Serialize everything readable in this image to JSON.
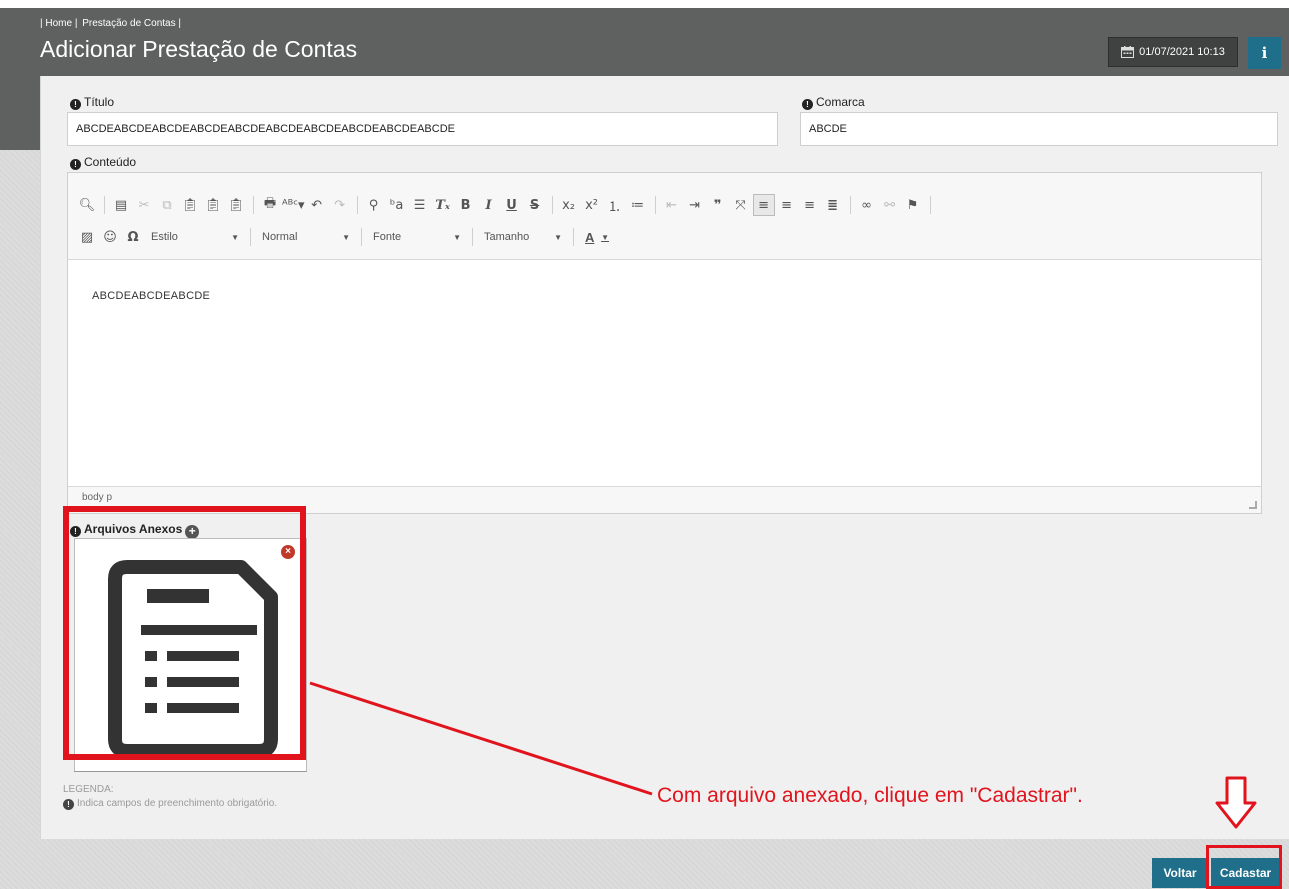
{
  "breadcrumb": [
    "| Home |",
    "Prestação de Contas |"
  ],
  "page": {
    "title": "Adicionar Prestação de Contas",
    "datetime": "01/07/2021 10:13"
  },
  "form": {
    "titulo": {
      "label": "Título",
      "value": "ABCDEABCDEABCDEABCDEABCDEABCDEABCDEABCDEABCDEABCDE"
    },
    "comarca": {
      "label": "Comarca",
      "value": "ABCDE"
    },
    "conteudo": {
      "label": "Conteúdo",
      "body_text": "ABCDEABCDEABCDE",
      "status_path": "body  p"
    },
    "toolbar": {
      "style_combo": "Estilo",
      "format_combo": "Normal",
      "font_combo": "Fonte",
      "size_combo": "Tamanho",
      "text_color": "A"
    },
    "attachments": {
      "label": "Arquivos Anexos"
    }
  },
  "legend": {
    "title": "LEGENDA:",
    "text": "Indica campos de preenchimento obrigatório."
  },
  "annotation": {
    "callout": "Com arquivo anexado, clique em \"Cadastrar\".",
    "color": "#e1141d"
  },
  "footer": {
    "back_label": "Voltar",
    "submit_label": "Cadastar"
  },
  "colors": {
    "header": "#5e6160",
    "primary_button": "#1f6f8b"
  }
}
